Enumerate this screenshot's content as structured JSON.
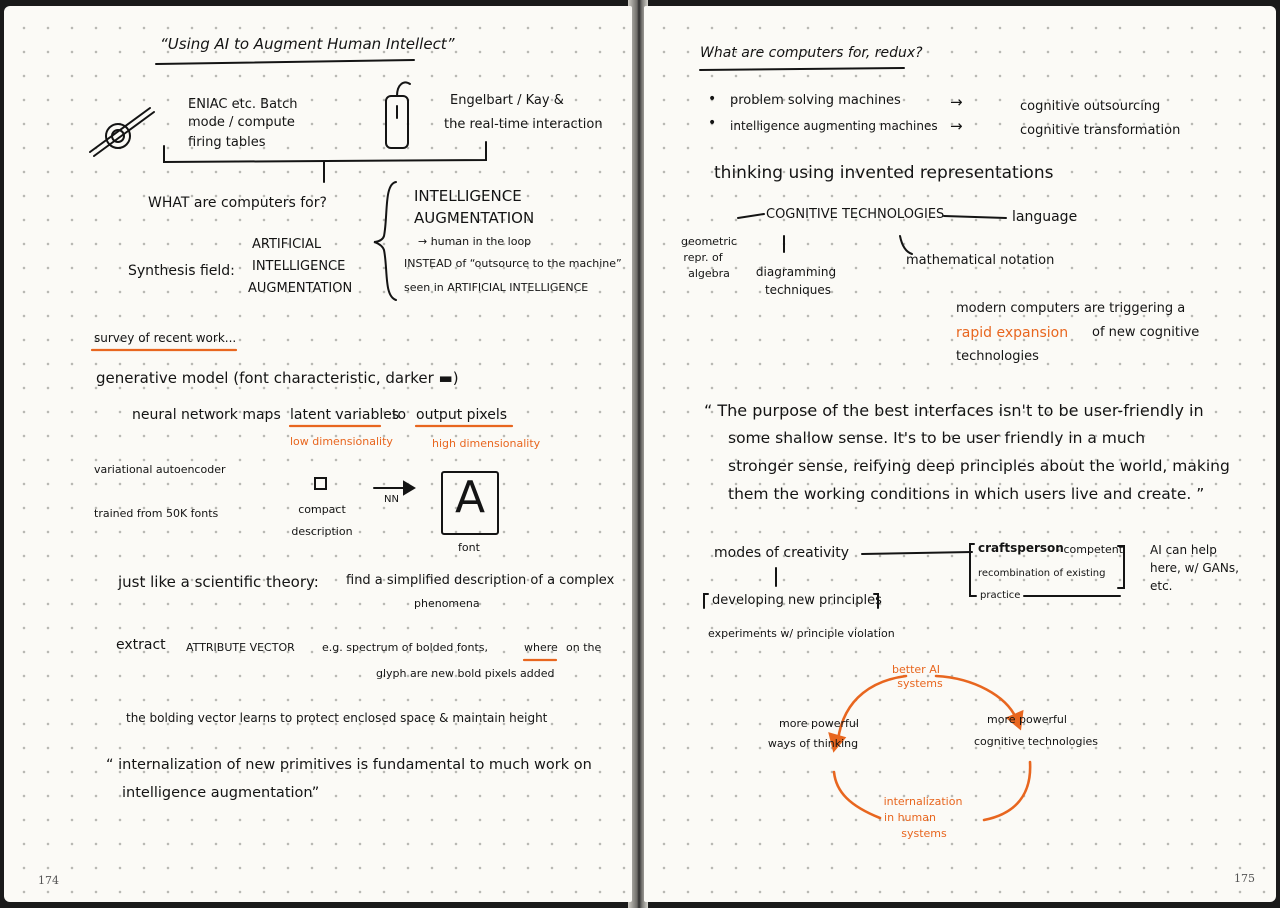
{
  "left": {
    "title": "“Using AI to Augment Human Intellect”",
    "eniac": [
      "ENIAC etc. Batch",
      "mode / compute",
      "firing tables"
    ],
    "engelbart": [
      "Engelbart / Kay &",
      "the real-time interaction"
    ],
    "what_for": "WHAT are computers for?",
    "synthesis_label": "Synthesis field:",
    "synthesis_terms": [
      "ARTIFICIAL",
      "INTELLIGENCE",
      "AUGMENTATION"
    ],
    "ia": [
      "INTELLIGENCE",
      "AUGMENTATION",
      "→ human in the loop",
      "INSTEAD of “outsource to the machine”",
      "seen in ARTIFICIAL INTELLIGENCE"
    ],
    "survey": "survey of recent work...",
    "generative": "generative model (font characteristic, darker ▬)",
    "neural": "neural network maps",
    "latent": "latent variables",
    "to": "to",
    "output": "output pixels",
    "low_dim": "low dimensionality",
    "high_dim": "high dimensionality",
    "vae": "variational autoencoder",
    "trained": "trained from 50K fonts",
    "compact": [
      "compact",
      "description"
    ],
    "nn": "NN",
    "glyph_letter": "A",
    "font_label": "font",
    "just_like": "just like a scientific theory:",
    "find": [
      "find a simplified description of a complex",
      "phenomena"
    ],
    "extract": "extract",
    "attr_vector": "ATTRIBUTE VECTOR",
    "eg": "e.g. spectrum of bolded fonts,",
    "where": "where",
    "on_the": "on the",
    "glyph_line": "glyph are new bold pixels added",
    "bolding": "the bolding vector learns to protect enclosed space & maintain height",
    "quote": [
      "“ internalization of new primitives is fundamental to much work on",
      "intelligence augmentation”"
    ],
    "page_number": "174"
  },
  "right": {
    "title": "What are computers for, redux?",
    "bullets": [
      {
        "left": "problem solving machines",
        "right": "cognitive outsourcing"
      },
      {
        "left": "intelligence augmenting machines",
        "right": "cognitive transformation"
      }
    ],
    "bullet_glyph": "•",
    "arrow_glyph": "→",
    "thinking": "thinking using invented representations",
    "cog_tech": "COGNITIVE TECHNOLOGIES",
    "language": "language",
    "geometric": [
      "geometric",
      "repr. of",
      "algebra"
    ],
    "diagramming": [
      "diagramming",
      "techniques"
    ],
    "math": "mathematical notation",
    "modern": [
      "modern computers are triggering a",
      "of new cognitive",
      "technologies"
    ],
    "rapid": "rapid expansion",
    "quote": [
      "“ The purpose of the best interfaces isn't to be user-friendly in",
      "some shallow sense. It's to be user friendly in a much",
      "stronger sense, reifying deep principles about the world, making",
      "them the working conditions in which users live and create. ”"
    ],
    "modes": "modes of creativity",
    "craftsperson": "craftsperson",
    "competent": "- competent",
    "recombination": "recombination of existing",
    "practice": "practice",
    "ai_help": [
      "AI can help",
      "here, w/ GANs,",
      "etc."
    ],
    "developing": "developing new principles",
    "experiments": "experiments w/ principle violation",
    "better_ai": [
      "better AI",
      "systems"
    ],
    "more_powerful_ways": [
      "more powerful",
      "ways of thinking"
    ],
    "more_powerful_cog": [
      "more powerful",
      "cognitive technologies"
    ],
    "internalization": [
      "internalization",
      "in human",
      "systems"
    ],
    "page_number": "175"
  },
  "colors": {
    "ink": "#141414",
    "accent": "#e8661f",
    "paper": "#fbfaf6"
  }
}
